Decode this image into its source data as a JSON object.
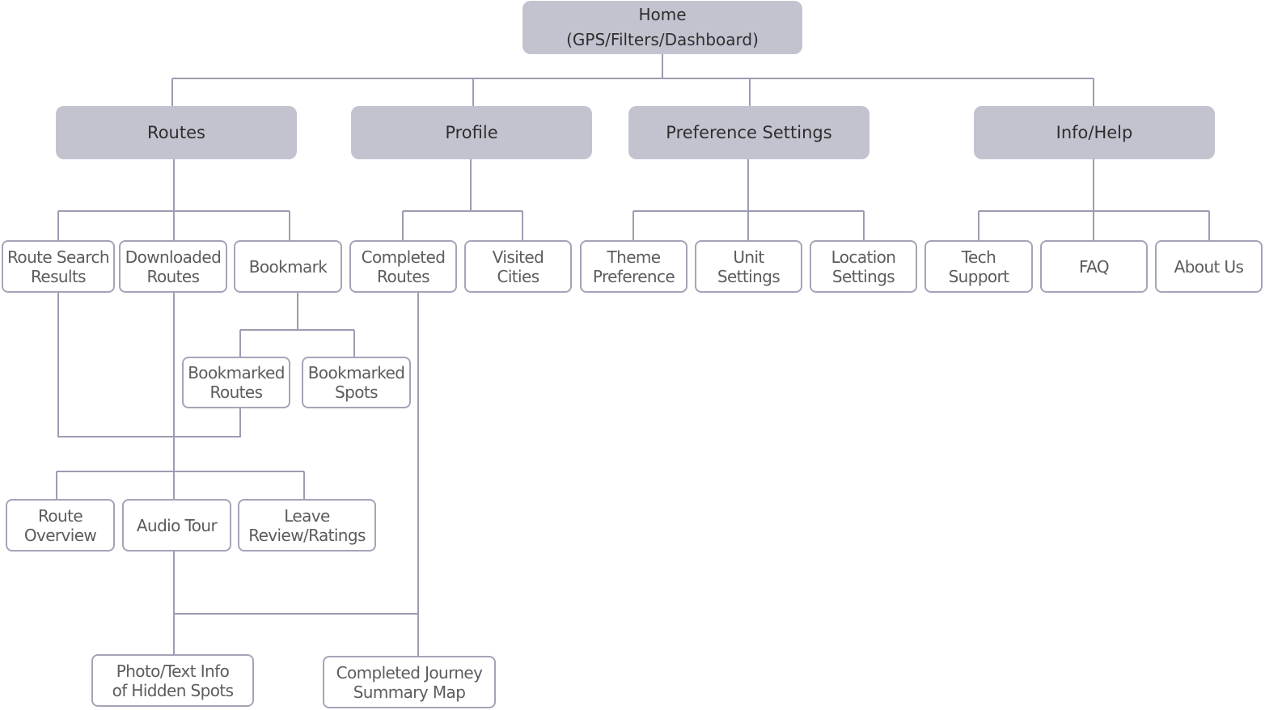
{
  "colors": {
    "primary_fill": "#c3c3d0",
    "line": "#9c9cb2",
    "border": "#a4a4b8"
  },
  "nodes": {
    "home": "Home\n(GPS/Filters/Dashboard)",
    "routes": "Routes",
    "profile": "Profile",
    "preference_settings": "Preference Settings",
    "info_help": "Info/Help",
    "route_search_results": "Route Search\nResults",
    "downloaded_routes": "Downloaded\nRoutes",
    "bookmark": "Bookmark",
    "completed_routes": "Completed\nRoutes",
    "visited_cities": "Visited\nCities",
    "theme_preference": "Theme\nPreference",
    "unit_settings": "Unit\nSettings",
    "location_settings": "Location\nSettings",
    "tech_support": "Tech\nSupport",
    "faq": "FAQ",
    "about_us": "About Us",
    "bookmarked_routes": "Bookmarked\nRoutes",
    "bookmarked_spots": "Bookmarked\nSpots",
    "route_overview": "Route\nOverview",
    "audio_tour": "Audio Tour",
    "leave_review_ratings": "Leave\nReview/Ratings",
    "photo_text_info": "Photo/Text Info\nof Hidden Spots",
    "completed_journey_summary_map": "Completed Journey\nSummary Map"
  }
}
